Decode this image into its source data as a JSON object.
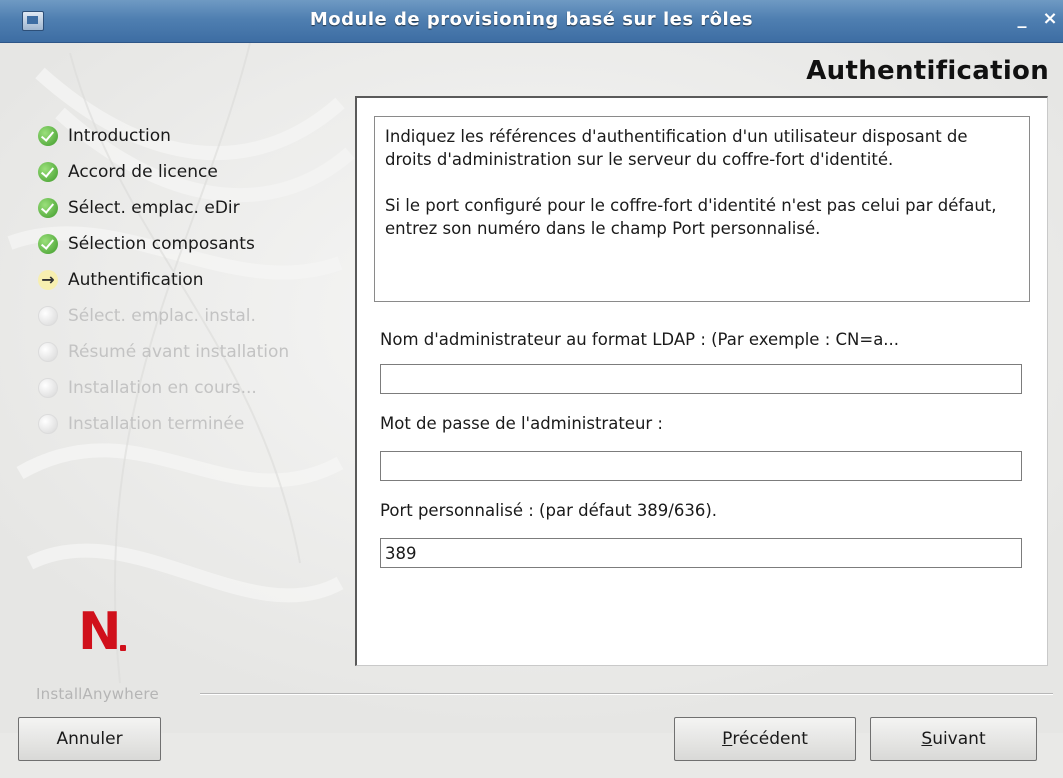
{
  "window": {
    "title": "Module de provisioning basé sur les rôles",
    "minimize_label": "_",
    "close_label": "×"
  },
  "page_heading": "Authentification",
  "steps": [
    {
      "label": "Introduction",
      "state": "done",
      "icon": "check-icon"
    },
    {
      "label": "Accord de licence",
      "state": "done",
      "icon": "check-icon"
    },
    {
      "label": "Sélect. emplac. eDir",
      "state": "done",
      "icon": "check-icon"
    },
    {
      "label": "Sélection composants",
      "state": "done",
      "icon": "check-icon"
    },
    {
      "label": "Authentification",
      "state": "current",
      "icon": "arrow-right-icon"
    },
    {
      "label": "Sélect. emplac. instal.",
      "state": "pending",
      "icon": "pending-dot-icon"
    },
    {
      "label": "Résumé avant installation",
      "state": "pending",
      "icon": "pending-dot-icon"
    },
    {
      "label": "Installation en cours...",
      "state": "pending",
      "icon": "pending-dot-icon"
    },
    {
      "label": "Installation terminée",
      "state": "pending",
      "icon": "pending-dot-icon"
    }
  ],
  "logo": {
    "letter": "N",
    "color": "#d0101b"
  },
  "installer_brand": "InstallAnywhere",
  "info": {
    "paragraph1": "Indiquez les références d'authentification d'un utilisateur disposant de droits d'administration sur le serveur du coffre-fort d'identité.",
    "paragraph2": "Si le port configuré pour le coffre-fort d'identité n'est pas celui par défaut, entrez son numéro dans le champ Port personnalisé."
  },
  "fields": {
    "admin_name": {
      "label": "Nom d'administrateur au format LDAP : (Par exemple : CN=a...",
      "value": ""
    },
    "admin_password": {
      "label": "Mot de passe de l'administrateur :",
      "value": ""
    },
    "custom_port": {
      "label": "Port personnalisé : (par défaut 389/636).",
      "value": "389"
    }
  },
  "buttons": {
    "cancel": "Annuler",
    "previous_mnemonic": "P",
    "previous_rest": "récédent",
    "next_mnemonic": "S",
    "next_rest": "uivant"
  },
  "colors": {
    "titlebar": "#4f7fb1",
    "logo_red": "#d0101b",
    "done_green": "#3e9a2a"
  }
}
